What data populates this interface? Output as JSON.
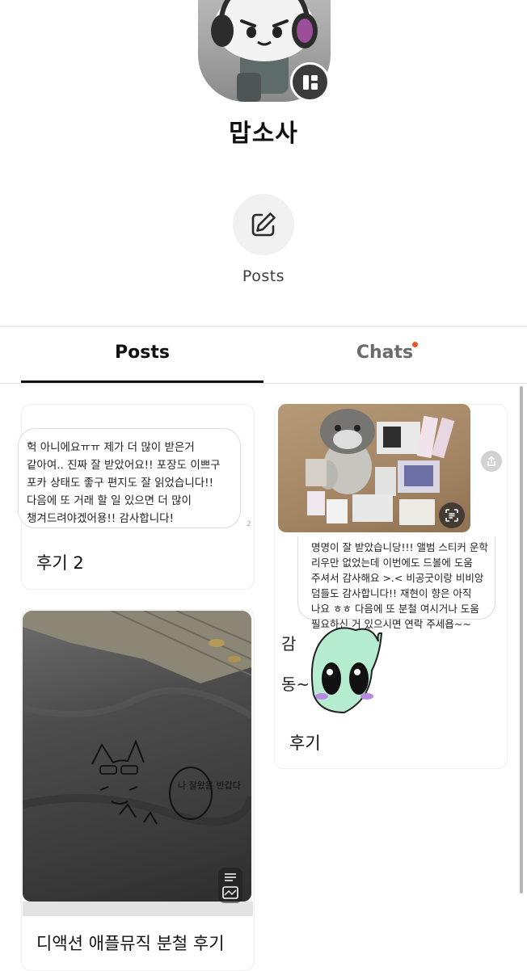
{
  "profile": {
    "name": "맙소사",
    "avatar_icon": "character-avatar",
    "badge_icon": "collection-icon",
    "action_icon": "edit-icon",
    "action_label": "Posts"
  },
  "tabs": [
    {
      "label": "Posts",
      "active": true
    },
    {
      "label": "Chats",
      "active": false,
      "has_notification_dot": true
    }
  ],
  "colors": {
    "notification_dot": "#e4572e",
    "active_tab": "#111111",
    "inactive_tab": "#6a6a6a"
  },
  "posts": [
    {
      "title": "후기 2",
      "note": "헉 아니에요ㅠㅠ 제가 더 많이 받은거 같아여.. 진짜 잘 받았어요!! 포장도 이쁘구 포카 상태도 좋구 편지도 잘 읽었습니다!! 다음에 또 거래 할 일 있으면 더 많이 챙겨드려야겠어용!! 감사합니다!",
      "note_number": "2"
    },
    {
      "title": "후기",
      "note": "명명이 잘 받았습니당!!! 앨범 스티커 운학 리우만 없었는데 이번에도 드볼에 도움 주셔서 감사해요 >.< 비공굿이랑 비비앙 덤들도 감사합니다!! 재현이 향은 아직 나요 ㅎㅎ 다음에 또 분철 여시거나 도움 필요하신 거 있으시면 연락 주세욥~~",
      "drawing_text": "감동~",
      "share_icon": "share-icon",
      "scan_icon": "scan-text-icon"
    },
    {
      "title": "디액션 애플뮤직 분철 후기",
      "photo_note": "나 잘왔음 반갑다",
      "icon": "image-gallery-icon"
    }
  ]
}
